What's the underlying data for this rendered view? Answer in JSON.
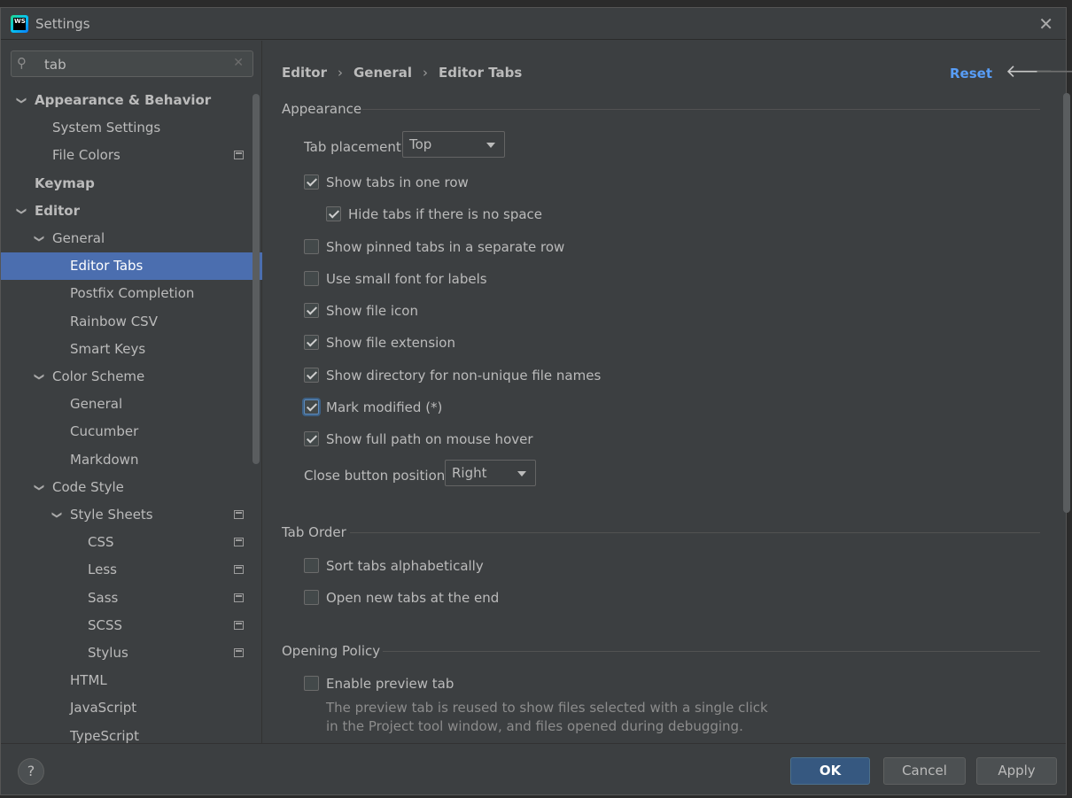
{
  "window": {
    "title": "Settings",
    "app_icon_text": "WS"
  },
  "search": {
    "value": "tab"
  },
  "tree": [
    {
      "label": "Appearance & Behavior",
      "level": 0,
      "chevron": "down",
      "bold": true,
      "y": 0
    },
    {
      "label": "System Settings",
      "level": 1,
      "y": 1
    },
    {
      "label": "File Colors",
      "level": 1,
      "y": 2,
      "project": true
    },
    {
      "label": "Keymap",
      "level": 0,
      "bold": true,
      "y": 3
    },
    {
      "label": "Editor",
      "level": 0,
      "chevron": "down",
      "bold": true,
      "y": 4
    },
    {
      "label": "General",
      "level": 1,
      "chevron": "down",
      "y": 5
    },
    {
      "label": "Editor Tabs",
      "level": 2,
      "selected": true,
      "y": 6
    },
    {
      "label": "Postfix Completion",
      "level": 2,
      "y": 7
    },
    {
      "label": "Rainbow CSV",
      "level": 2,
      "y": 8
    },
    {
      "label": "Smart Keys",
      "level": 2,
      "y": 9
    },
    {
      "label": "Color Scheme",
      "level": 1,
      "chevron": "down",
      "y": 10
    },
    {
      "label": "General",
      "level": 2,
      "y": 11
    },
    {
      "label": "Cucumber",
      "level": 2,
      "y": 12
    },
    {
      "label": "Markdown",
      "level": 2,
      "y": 13
    },
    {
      "label": "Code Style",
      "level": 1,
      "chevron": "down",
      "y": 14
    },
    {
      "label": "Style Sheets",
      "level": 2,
      "chevron": "down",
      "y": 15,
      "project": true
    },
    {
      "label": "CSS",
      "level": 3,
      "y": 16,
      "project": true
    },
    {
      "label": "Less",
      "level": 3,
      "y": 17,
      "project": true
    },
    {
      "label": "Sass",
      "level": 3,
      "y": 18,
      "project": true
    },
    {
      "label": "SCSS",
      "level": 3,
      "y": 19,
      "project": true
    },
    {
      "label": "Stylus",
      "level": 3,
      "y": 20,
      "project": true
    },
    {
      "label": "HTML",
      "level": 2,
      "y": 21
    },
    {
      "label": "JavaScript",
      "level": 2,
      "y": 22
    },
    {
      "label": "TypeScript",
      "level": 2,
      "y": 23
    }
  ],
  "breadcrumb": [
    "Editor",
    "General",
    "Editor Tabs"
  ],
  "header": {
    "reset": "Reset"
  },
  "appearance": {
    "title": "Appearance",
    "tab_placement_label": "Tab placement:",
    "tab_placement_value": "Top",
    "options": [
      {
        "label": "Show tabs in one row",
        "checked": true
      },
      {
        "label": "Hide tabs if there is no space",
        "checked": true,
        "indent": true
      },
      {
        "label": "Show pinned tabs in a separate row",
        "checked": false
      },
      {
        "label": "Use small font for labels",
        "checked": false
      },
      {
        "label": "Show file icon",
        "checked": true
      },
      {
        "label": "Show file extension",
        "checked": true
      },
      {
        "label": "Show directory for non-unique file names",
        "checked": true
      },
      {
        "label": "Mark modified (*)",
        "checked": true,
        "focused": true
      },
      {
        "label": "Show full path on mouse hover",
        "checked": true
      }
    ],
    "close_button_label": "Close button position:",
    "close_button_value": "Right"
  },
  "tab_order": {
    "title": "Tab Order",
    "options": [
      {
        "label": "Sort tabs alphabetically",
        "checked": false
      },
      {
        "label": "Open new tabs at the end",
        "checked": false
      }
    ]
  },
  "opening_policy": {
    "title": "Opening Policy",
    "options": [
      {
        "label": "Enable preview tab",
        "checked": false
      }
    ],
    "description_line1": "The preview tab is reused to show files selected with a single click",
    "description_line2": "in the Project tool window, and files opened during debugging."
  },
  "buttons": {
    "help": "?",
    "ok": "OK",
    "cancel": "Cancel",
    "apply": "Apply"
  }
}
